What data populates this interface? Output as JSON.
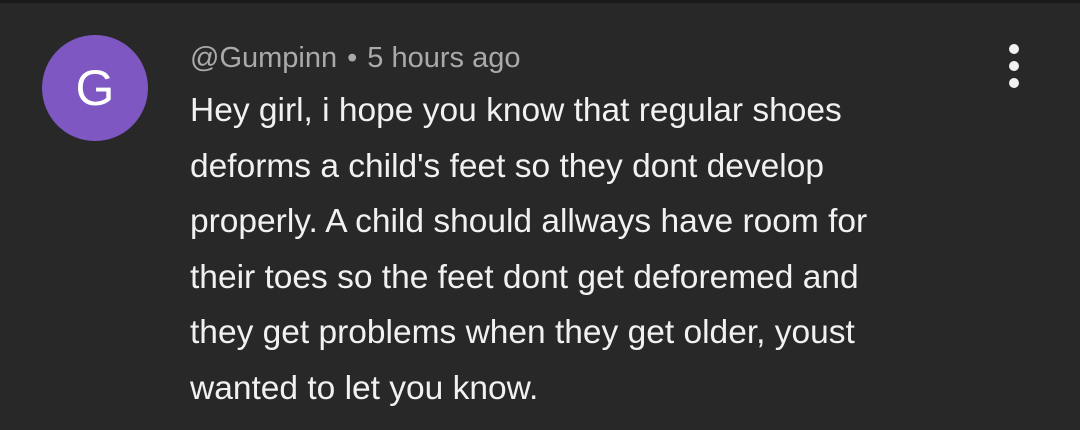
{
  "comment": {
    "avatar_letter": "G",
    "author": "@Gumpinn",
    "separator": "•",
    "timestamp": "5 hours ago",
    "text_lines": [
      "Hey girl, i hope you know that regular shoes",
      "deforms a child's feet so they dont develop",
      "properly. A child should allways have room for",
      "their toes so the feet dont get deforemed and",
      "they get problems when they get older, youst",
      "wanted to let you know."
    ],
    "menu_icon": "more-vert-icon"
  },
  "colors": {
    "background": "#282828",
    "avatar": "#7e57c2",
    "meta_text": "#aaaaaa",
    "body_text": "#f1f1f1"
  }
}
